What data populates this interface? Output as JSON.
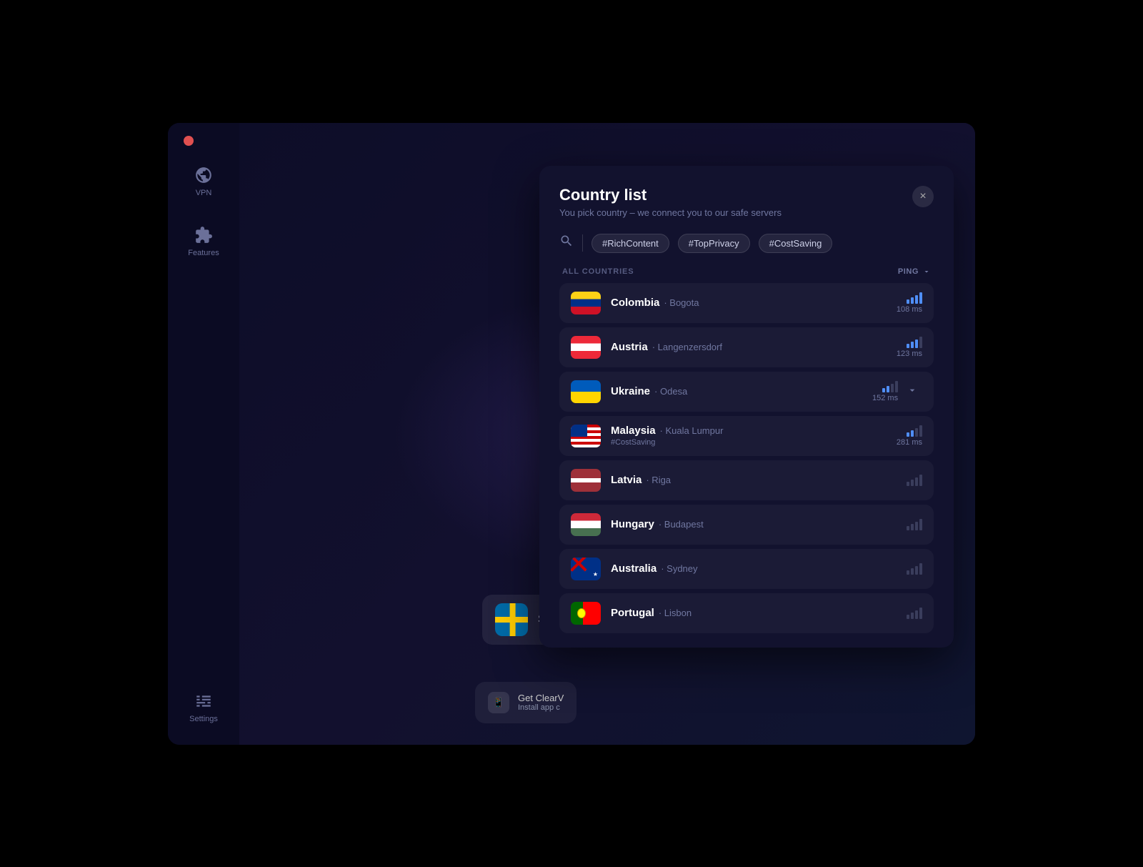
{
  "window": {
    "traffic_light_color": "#e05050"
  },
  "sidebar": {
    "items": [
      {
        "id": "vpn",
        "label": "VPN"
      },
      {
        "id": "features",
        "label": "Features"
      }
    ],
    "bottom_item": {
      "id": "settings",
      "label": "Settings"
    }
  },
  "background": {
    "current_server": "Sweden"
  },
  "get_app_card": {
    "title": "Get ClearV",
    "subtitle": "Install app c"
  },
  "modal": {
    "title": "Country list",
    "subtitle": "You pick country – we connect you to our safe servers",
    "close_label": "×",
    "search_placeholder": "Search",
    "filters": [
      "#RichContent",
      "#TopPrivacy",
      "#CostSaving"
    ],
    "section_title": "ALL COUNTRIES",
    "sort_label": "PING",
    "countries": [
      {
        "id": "colombia",
        "name": "Colombia",
        "city": "Bogota",
        "ping": "108 ms",
        "ping_bars": [
          3,
          3,
          3,
          3
        ],
        "tag": null,
        "expanded": false
      },
      {
        "id": "austria",
        "name": "Austria",
        "city": "Langenzersdorf",
        "ping": "123 ms",
        "ping_bars": [
          3,
          3,
          3,
          2
        ],
        "tag": null,
        "expanded": false
      },
      {
        "id": "ukraine",
        "name": "Ukraine",
        "city": "Odesa",
        "ping": "152 ms",
        "ping_bars": [
          3,
          3,
          2,
          1
        ],
        "tag": null,
        "expanded": true
      },
      {
        "id": "malaysia",
        "name": "Malaysia",
        "city": "Kuala Lumpur",
        "ping": "281 ms",
        "ping_bars": [
          2,
          2,
          1,
          0
        ],
        "tag": "#CostSaving",
        "expanded": false
      },
      {
        "id": "latvia",
        "name": "Latvia",
        "city": "Riga",
        "ping": null,
        "ping_bars": [
          1,
          1,
          1,
          0
        ],
        "tag": null,
        "expanded": false
      },
      {
        "id": "hungary",
        "name": "Hungary",
        "city": "Budapest",
        "ping": null,
        "ping_bars": [
          1,
          1,
          1,
          0
        ],
        "tag": null,
        "expanded": false
      },
      {
        "id": "australia",
        "name": "Australia",
        "city": "Sydney",
        "ping": null,
        "ping_bars": [
          1,
          1,
          1,
          0
        ],
        "tag": null,
        "expanded": false
      },
      {
        "id": "portugal",
        "name": "Portugal",
        "city": "Lisbon",
        "ping": null,
        "ping_bars": [
          1,
          1,
          1,
          0
        ],
        "tag": null,
        "expanded": false
      }
    ]
  }
}
